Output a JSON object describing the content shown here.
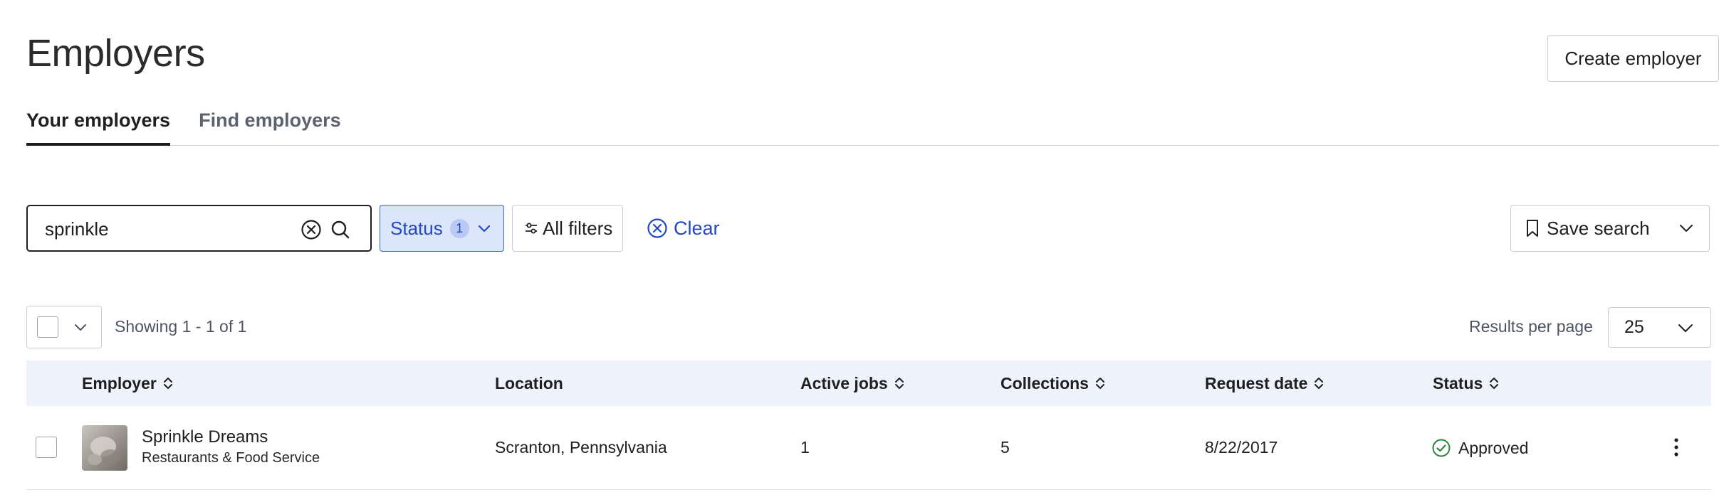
{
  "header": {
    "title": "Employers",
    "create_label": "Create employer"
  },
  "tabs": [
    {
      "label": "Your employers",
      "active": true
    },
    {
      "label": "Find employers",
      "active": false
    }
  ],
  "search": {
    "value": "sprinkle"
  },
  "filters": {
    "status_label": "Status",
    "status_count": "1",
    "all_filters_label": "All filters",
    "clear_label": "Clear",
    "save_search_label": "Save search"
  },
  "table_controls": {
    "showing": "Showing 1 - 1 of 1",
    "results_per_page_label": "Results per page",
    "results_per_page_value": "25"
  },
  "columns": [
    {
      "label": "Employer",
      "sortable": true
    },
    {
      "label": "Location",
      "sortable": false
    },
    {
      "label": "Active jobs",
      "sortable": true
    },
    {
      "label": "Collections",
      "sortable": true
    },
    {
      "label": "Request date",
      "sortable": true
    },
    {
      "label": "Status",
      "sortable": true
    }
  ],
  "rows": [
    {
      "name": "Sprinkle Dreams",
      "industry": "Restaurants & Food Service",
      "location": "Scranton, Pennsylvania",
      "active_jobs": "1",
      "collections": "5",
      "request_date": "8/22/2017",
      "status": "Approved"
    }
  ],
  "colors": {
    "accent": "#2448c2",
    "filter_bg": "#dce6fb",
    "header_bg": "#eef2fa",
    "approved": "#2e8540"
  },
  "icons": {
    "clear": "circle-x-icon",
    "search": "search-icon",
    "chevron": "chevron-down-icon",
    "filters": "sliders-icon",
    "bookmark": "bookmark-icon",
    "sort": "sort-icon",
    "approved": "check-circle-icon",
    "more": "kebab-icon"
  }
}
